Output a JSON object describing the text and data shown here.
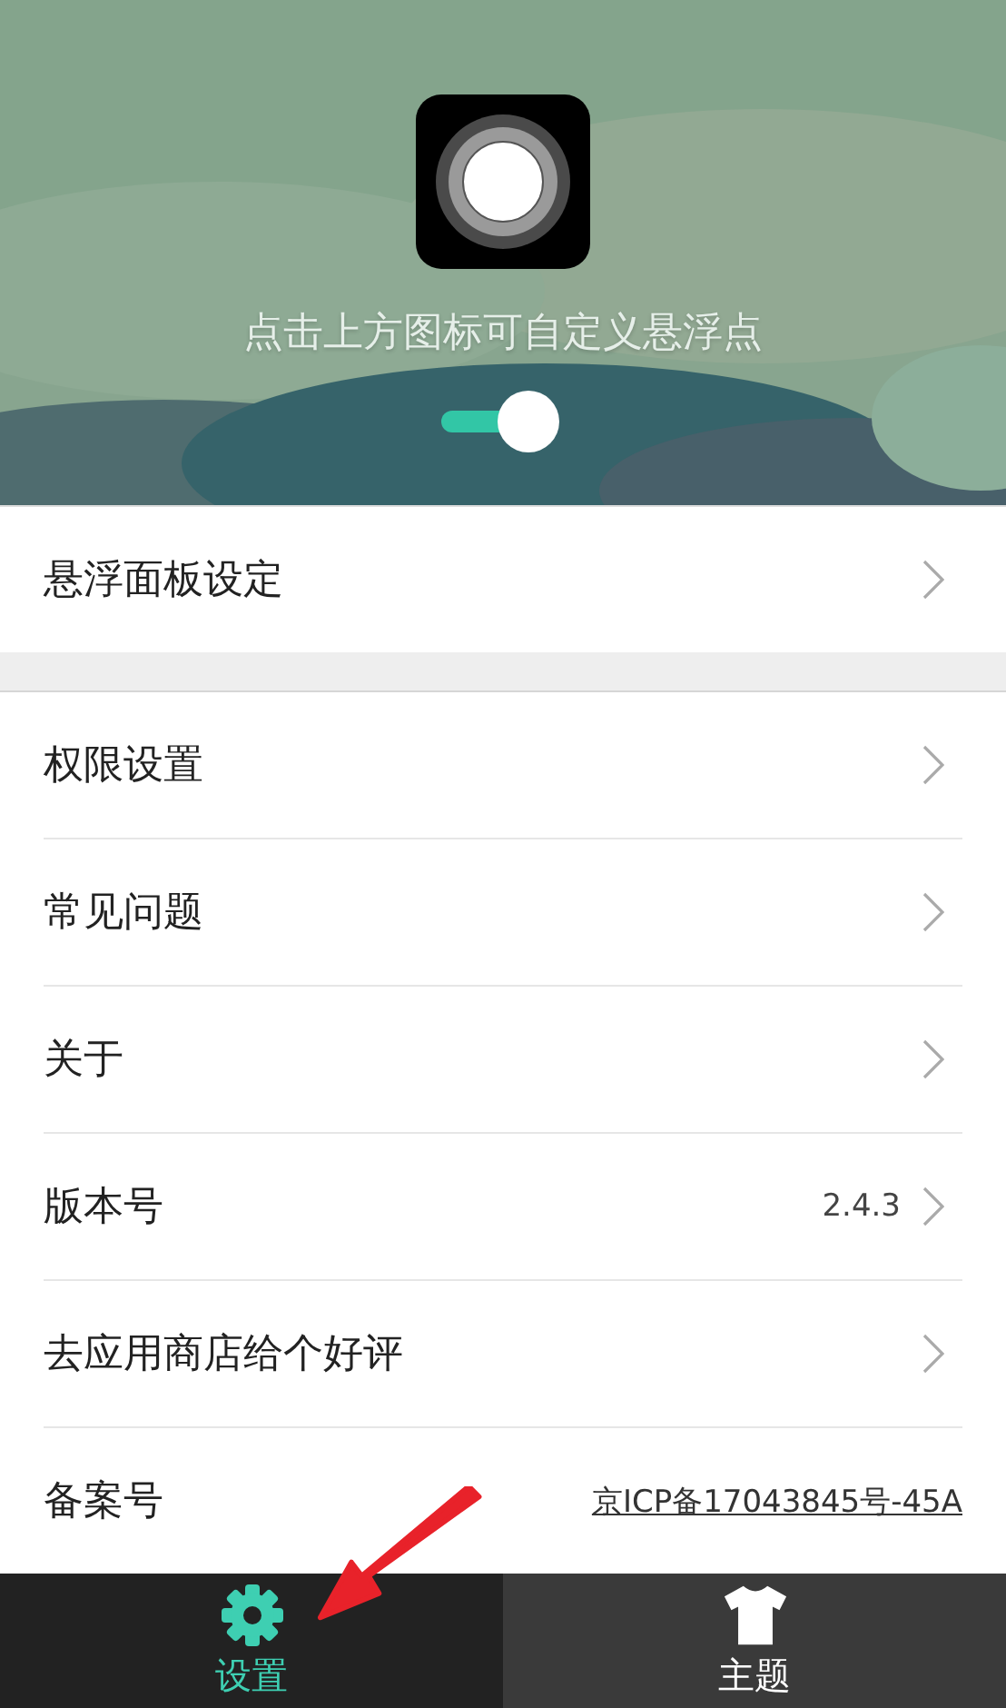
{
  "header": {
    "hint": "点击上方图标可自定义悬浮点",
    "toggle": {
      "on": true
    }
  },
  "sections": [
    {
      "items": [
        {
          "kind": "link",
          "label": "悬浮面板设定"
        }
      ]
    },
    {
      "items": [
        {
          "kind": "link",
          "label": "权限设置"
        },
        {
          "kind": "link",
          "label": "常见问题"
        },
        {
          "kind": "link",
          "label": "关于"
        },
        {
          "kind": "value",
          "label": "版本号",
          "value": "2.4.3"
        },
        {
          "kind": "link",
          "label": "去应用商店给个好评"
        },
        {
          "kind": "url",
          "label": "备案号",
          "value": "京ICP备17043845号-45A"
        }
      ]
    }
  ],
  "tabs": [
    {
      "kind": "gear",
      "label": "设置",
      "selected": true
    },
    {
      "kind": "shirt",
      "label": "主题",
      "selected": false
    }
  ]
}
